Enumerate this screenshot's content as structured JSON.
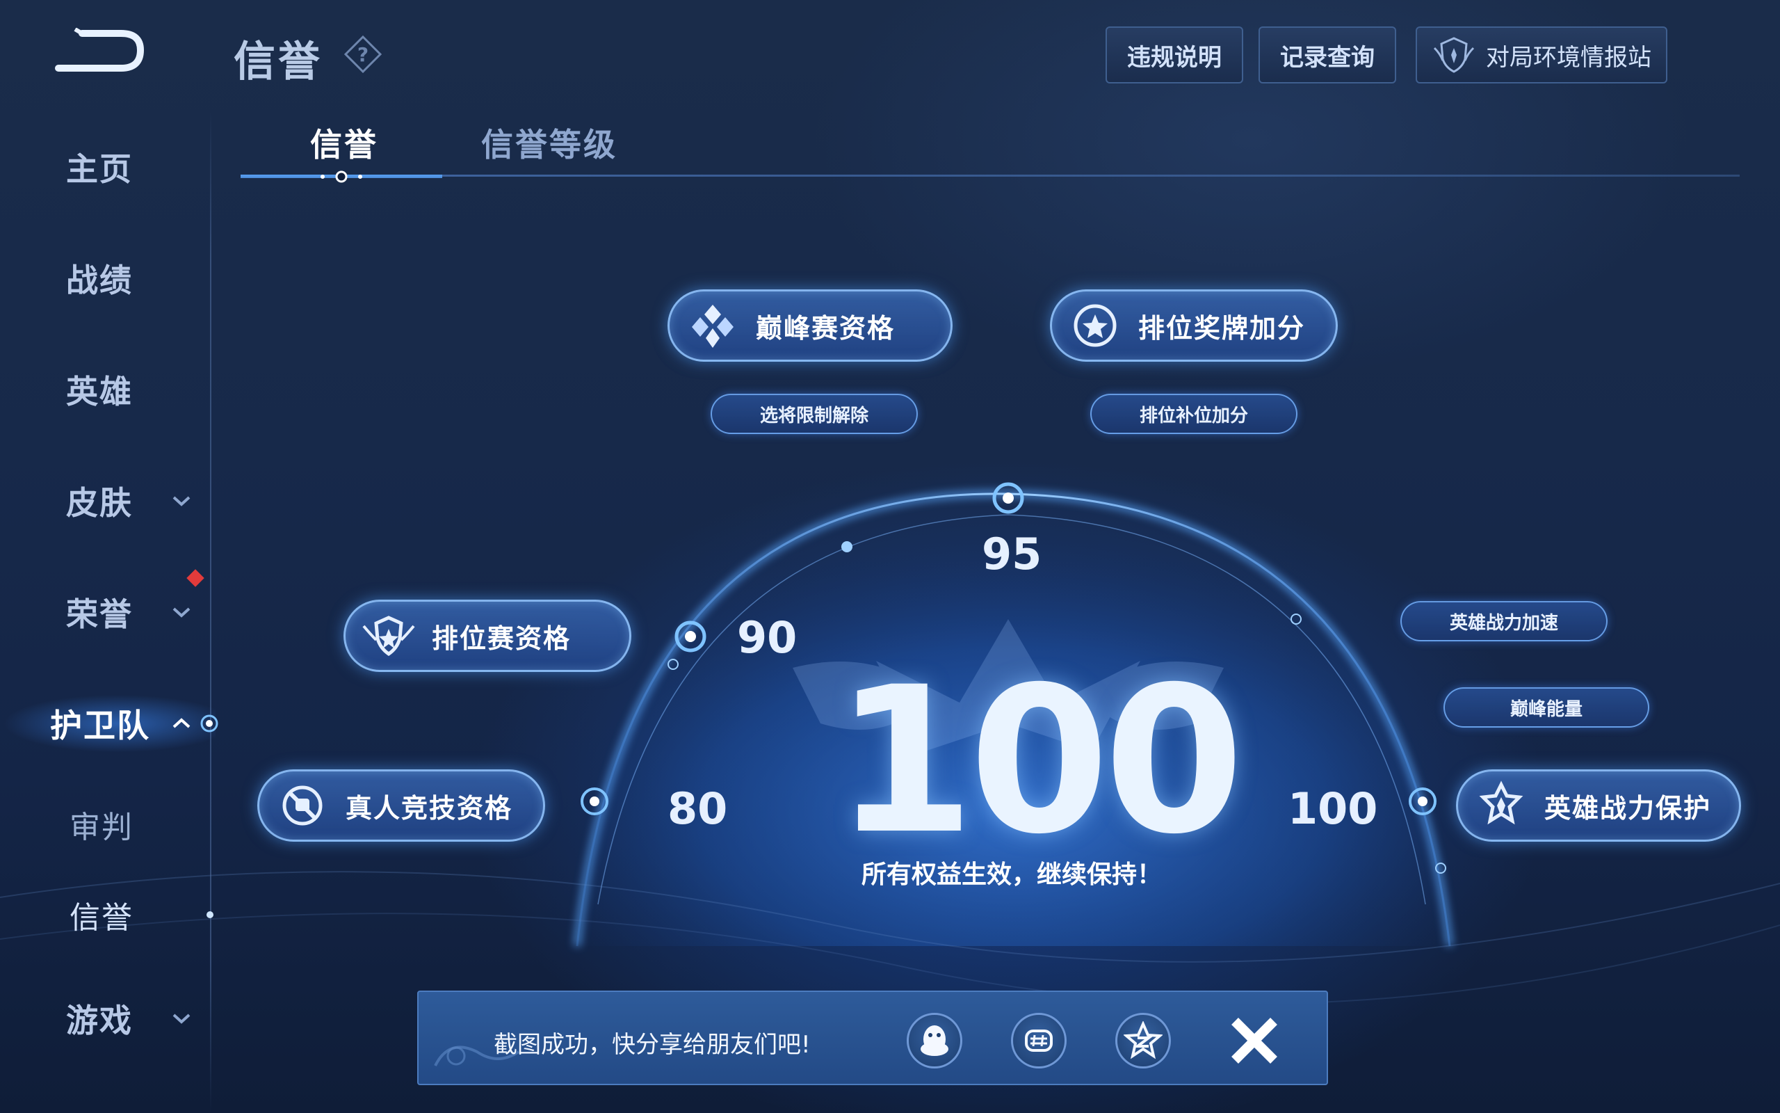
{
  "header": {
    "title": "信誉",
    "buttons": {
      "violation_info": "违规说明",
      "record_query": "记录查询",
      "report_station": "对局环境情报站"
    }
  },
  "tabs": [
    {
      "label": "信誉",
      "active": true
    },
    {
      "label": "信誉等级",
      "active": false
    }
  ],
  "sidebar": {
    "items": [
      {
        "label": "主页"
      },
      {
        "label": "战绩"
      },
      {
        "label": "英雄"
      },
      {
        "label": "皮肤"
      },
      {
        "label": "荣誉"
      },
      {
        "label": "护卫队"
      },
      {
        "label": "审判"
      },
      {
        "label": "信誉"
      },
      {
        "label": "游戏"
      }
    ]
  },
  "credit": {
    "score": "100",
    "status": "所有权益生效，继续保持！",
    "thresholds": {
      "t80": "80",
      "t90": "90",
      "t95": "95",
      "t100": "100"
    }
  },
  "benefits": {
    "peak_match": "巅峰赛资格",
    "rank_medal": "排位奖牌加分",
    "hero_pick_unlock": "选将限制解除",
    "rank_fill_bonus": "排位补位加分",
    "ranked_match": "排位赛资格",
    "real_player": "真人竞技资格",
    "hero_power_boost": "英雄战力加速",
    "peak_energy": "巅峰能量",
    "hero_power_protect": "英雄战力保护"
  },
  "toast": {
    "message": "截图成功，快分享给朋友们吧!",
    "share_targets": [
      "qq-icon",
      "wechat-moments-icon",
      "qzone-icon"
    ]
  },
  "colors": {
    "accent": "#5aa8ff",
    "background": "#17294a",
    "toast": "#2a5592",
    "alert": "#e23b3b"
  }
}
